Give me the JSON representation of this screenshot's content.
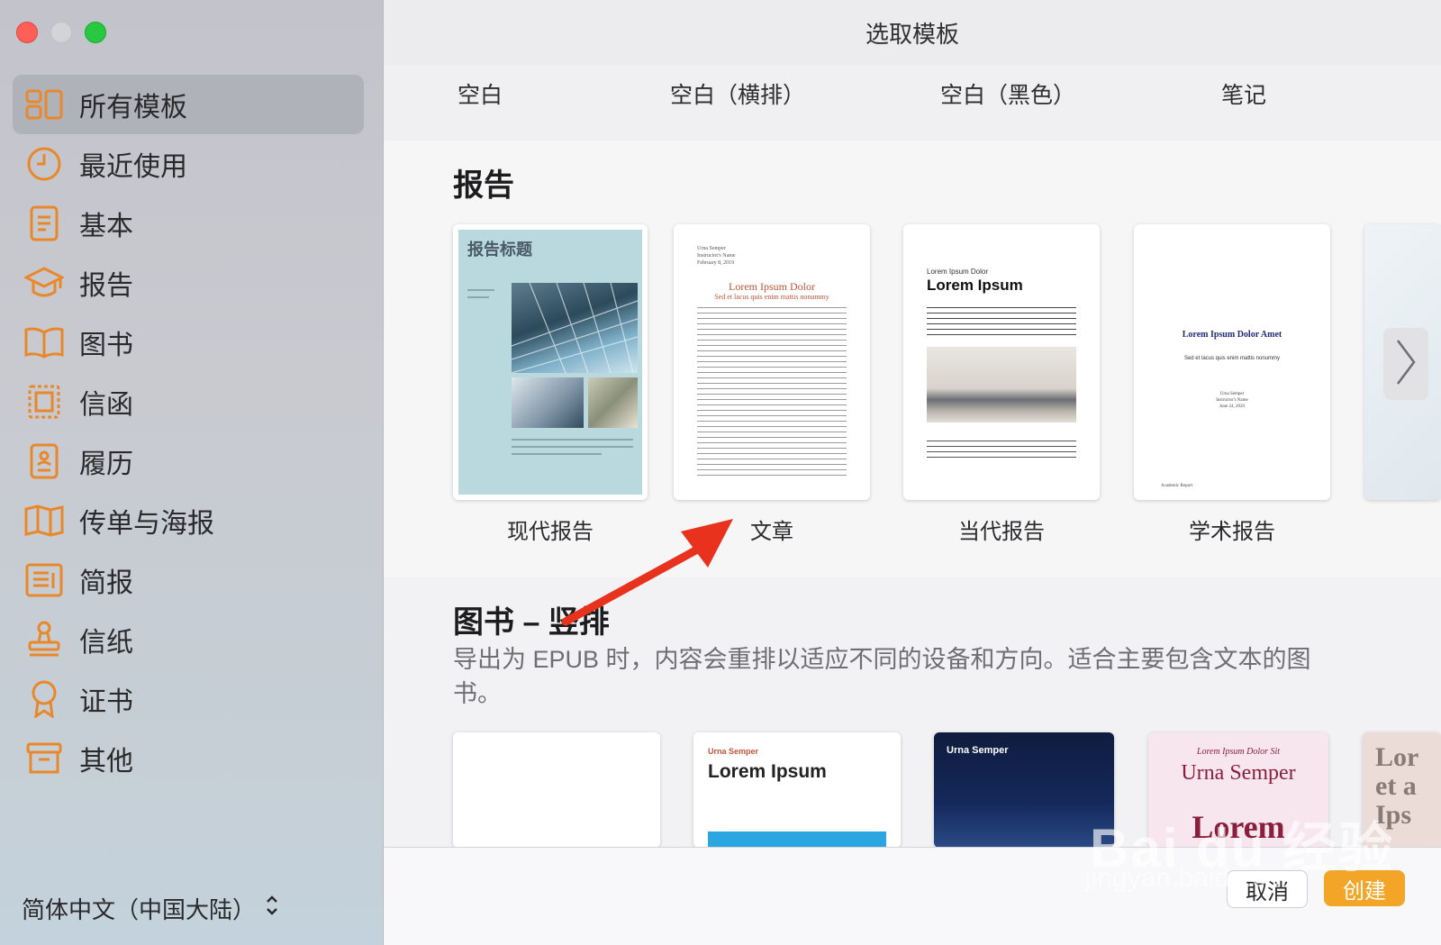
{
  "window": {
    "title": "选取模板"
  },
  "sidebar": {
    "items": [
      {
        "label": "所有模板",
        "icon": "grid-icon",
        "active": true
      },
      {
        "label": "最近使用",
        "icon": "clock-icon"
      },
      {
        "label": "基本",
        "icon": "document-icon"
      },
      {
        "label": "报告",
        "icon": "graduation-cap-icon"
      },
      {
        "label": "图书",
        "icon": "book-icon"
      },
      {
        "label": "信函",
        "icon": "stamp-frame-icon"
      },
      {
        "label": "履历",
        "icon": "resume-icon"
      },
      {
        "label": "传单与海报",
        "icon": "map-fold-icon"
      },
      {
        "label": "简报",
        "icon": "newsletter-icon"
      },
      {
        "label": "信纸",
        "icon": "rubber-stamp-icon"
      },
      {
        "label": "证书",
        "icon": "ribbon-icon"
      },
      {
        "label": "其他",
        "icon": "archive-box-icon"
      }
    ],
    "language": "简体中文（中国大陆）"
  },
  "blank_templates": [
    "空白",
    "空白（横排）",
    "空白（黑色）",
    "笔记"
  ],
  "reports": {
    "title": "报告",
    "templates": [
      {
        "label": "现代报告",
        "thumb_title": "报告标题"
      },
      {
        "label": "文章",
        "thumb_name": "Urna Semper",
        "thumb_instr": "Instructor's Name",
        "thumb_date": "February 8, 2019",
        "thumb_title": "Lorem Ipsum Dolor",
        "thumb_sub": "Sed et lacus quis enim mattis nonummy"
      },
      {
        "label": "当代报告",
        "thumb_head": "Lorem Ipsum Dolor",
        "thumb_title": "Lorem Ipsum"
      },
      {
        "label": "学术报告",
        "thumb_title": "Lorem Ipsum Dolor Amet",
        "thumb_sub": "Sed et lacus quis enim mattis nonummy",
        "thumb_name": "Urna Semper",
        "thumb_instr": "Instructor's Name",
        "thumb_date": "June 24, 2020",
        "thumb_footer": "Academic Report"
      }
    ]
  },
  "books": {
    "title": "图书 – 竖排",
    "description": "导出为 EPUB 时，内容会重排以适应不同的设备和方向。适合主要包含文本的图书。",
    "templates": [
      {
        "author": "",
        "title": ""
      },
      {
        "author": "Urna Semper",
        "title": "Lorem Ipsum"
      },
      {
        "author": "Urna Semper",
        "title": ""
      },
      {
        "author": "Lorem Ipsum Dolor Sit",
        "title": "Urna Semper",
        "subtitle": "Lorem"
      },
      {
        "author": "",
        "title": "Lor et a Ips"
      }
    ]
  },
  "footer": {
    "cancel": "取消",
    "create": "创建"
  },
  "colors": {
    "accent": "#f2a526",
    "sidebar_icon": "#e8882a",
    "annotation_arrow": "#e8321e"
  }
}
